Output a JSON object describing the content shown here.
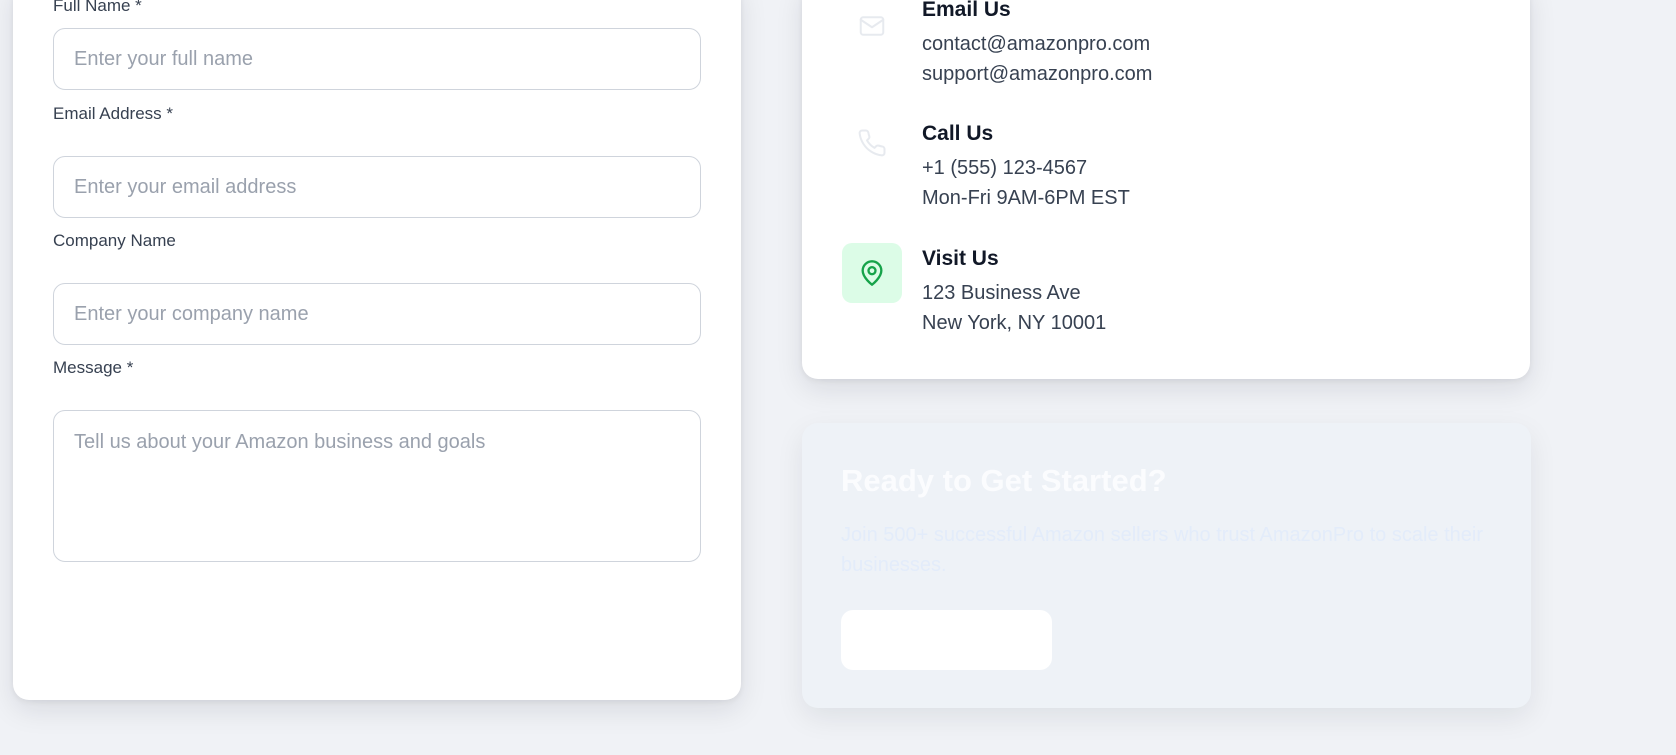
{
  "form": {
    "full_name": {
      "label": "Full Name *",
      "placeholder": "Enter your full name"
    },
    "email": {
      "label": "Email Address *",
      "placeholder": "Enter your email address"
    },
    "company": {
      "label": "Company Name",
      "placeholder": "Enter your company name"
    },
    "message": {
      "label": "Message *",
      "placeholder": "Tell us about your Amazon business and goals"
    }
  },
  "contact": {
    "email": {
      "title": "Email Us",
      "lines": [
        "contact@amazonpro.com",
        "support@amazonpro.com"
      ],
      "icon": "mail-icon"
    },
    "phone": {
      "title": "Call Us",
      "lines": [
        "+1 (555) 123-4567",
        "Mon-Fri 9AM-6PM EST"
      ],
      "icon": "phone-icon"
    },
    "visit": {
      "title": "Visit Us",
      "lines": [
        "123 Business Ave",
        "New York, NY 10001"
      ],
      "icon": "map-pin-icon"
    }
  },
  "cta": {
    "title": "Ready to Get Started?",
    "text": "Join 500+ successful Amazon sellers who trust AmazonPro to scale their businesses."
  },
  "colors": {
    "page_background": "#f0f2f6",
    "card_background": "#ffffff",
    "pin_icon": "#16a34a",
    "pin_icon_background": "#dcfce7",
    "heading_text": "#111827",
    "body_text": "#374151",
    "placeholder_text": "#9aa1ad"
  }
}
